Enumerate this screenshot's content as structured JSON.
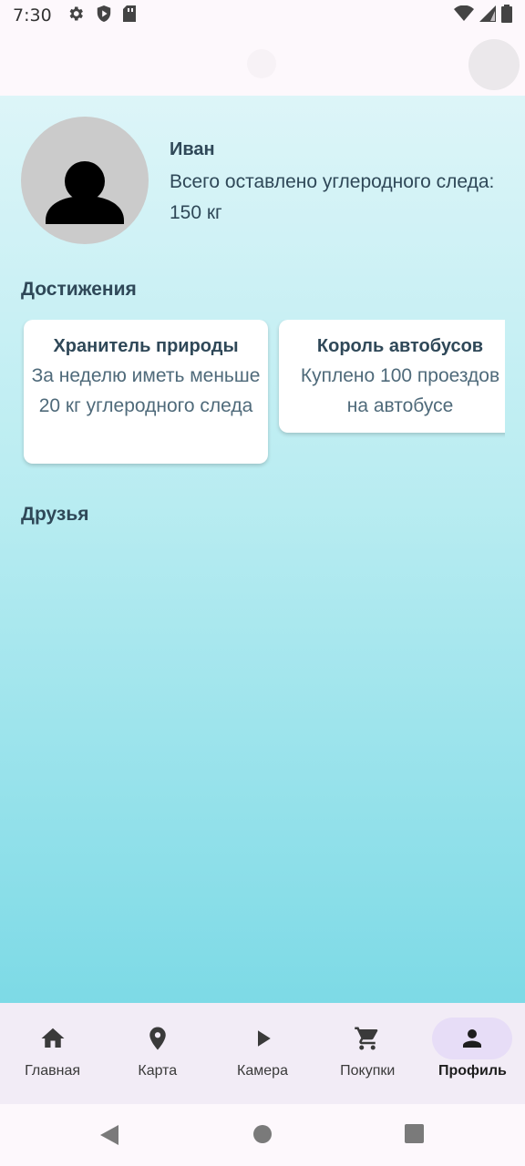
{
  "status_bar": {
    "time": "7:30",
    "left_icons": [
      "settings-icon",
      "shield-icon",
      "sim-card-icon"
    ],
    "right_icons": [
      "wifi-icon",
      "signal-icon",
      "battery-icon"
    ]
  },
  "profile": {
    "name": "Иван",
    "stats_text": "Всего оставлено углеродного следа: 150 кг",
    "avatar_icon": "person-icon"
  },
  "achievements": {
    "title": "Достижения",
    "items": [
      {
        "title": "Хранитель природы",
        "description": "За неделю иметь меньше 20 кг углеродного следа"
      },
      {
        "title": "Король автобусов",
        "description": "Куплено 100 проездов на автобусе"
      }
    ]
  },
  "friends": {
    "title": "Друзья"
  },
  "bottom_nav": {
    "items": [
      {
        "label": "Главная",
        "icon": "home-icon",
        "active": false
      },
      {
        "label": "Карта",
        "icon": "map-pin-icon",
        "active": false
      },
      {
        "label": "Камера",
        "icon": "play-icon",
        "active": false
      },
      {
        "label": "Покупки",
        "icon": "cart-icon",
        "active": false
      },
      {
        "label": "Профиль",
        "icon": "person-icon",
        "active": true
      }
    ]
  },
  "system_nav": {
    "buttons": [
      "back-icon",
      "home-circle-icon",
      "recents-icon"
    ]
  },
  "colors": {
    "background_top": "#ddf5f8",
    "background_bottom": "#7ddae6",
    "text_primary": "#2f4858",
    "nav_background": "#f2ecf6",
    "nav_active_pill": "#e7ddf7"
  }
}
